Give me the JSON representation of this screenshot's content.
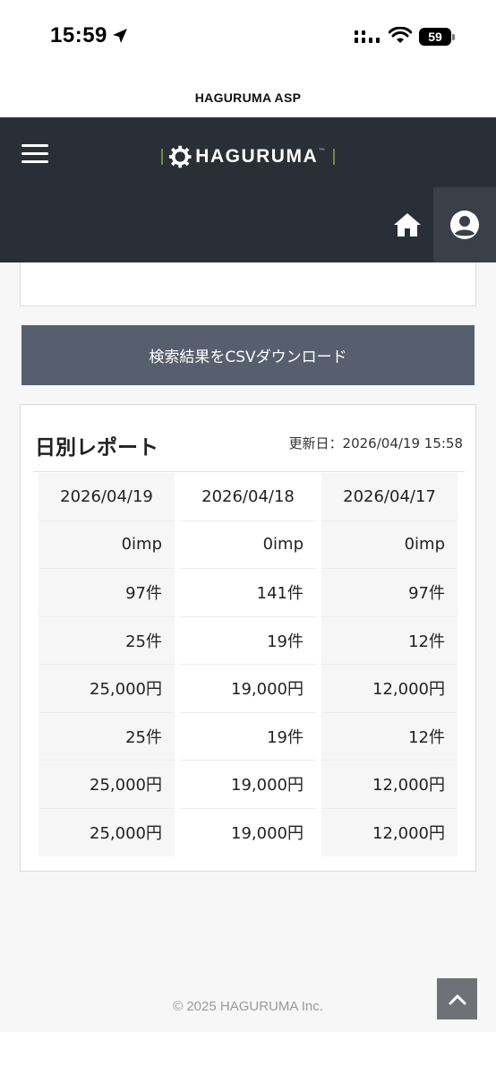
{
  "status_bar": {
    "time": "15:59",
    "battery": "59"
  },
  "site": {
    "title": "HAGURUMA ASP"
  },
  "header": {
    "logo_text": "HAGURUMA",
    "logo_mark": "™",
    "icons": {
      "menu": "hamburger-icon",
      "home": "home-icon",
      "account": "account-circle-icon"
    },
    "colors": {
      "background": "#2a2e36",
      "account_bg": "#3a3f48",
      "logo_accent": "#6b8f3a"
    }
  },
  "actions": {
    "csv_download_label": "検索結果をCSVダウンロード",
    "csv_button_color": "#575f6e"
  },
  "report": {
    "title": "日別レポート",
    "updated_label": "更新日：2026/04/19 15:58",
    "columns": [
      "2026/04/19",
      "2026/04/18",
      "2026/04/17"
    ],
    "rows": [
      [
        "0imp",
        "0imp",
        "0imp"
      ],
      [
        "97件",
        "141件",
        "97件"
      ],
      [
        "25件",
        "19件",
        "12件"
      ],
      [
        "25,000円",
        "19,000円",
        "12,000円"
      ],
      [
        "25件",
        "19件",
        "12件"
      ],
      [
        "25,000円",
        "19,000円",
        "12,000円"
      ],
      [
        "25,000円",
        "19,000円",
        "12,000円"
      ]
    ]
  },
  "footer": {
    "copyright": "© 2025 HAGURUMA Inc.",
    "scroll_top_icon": "chevron-up-icon"
  }
}
